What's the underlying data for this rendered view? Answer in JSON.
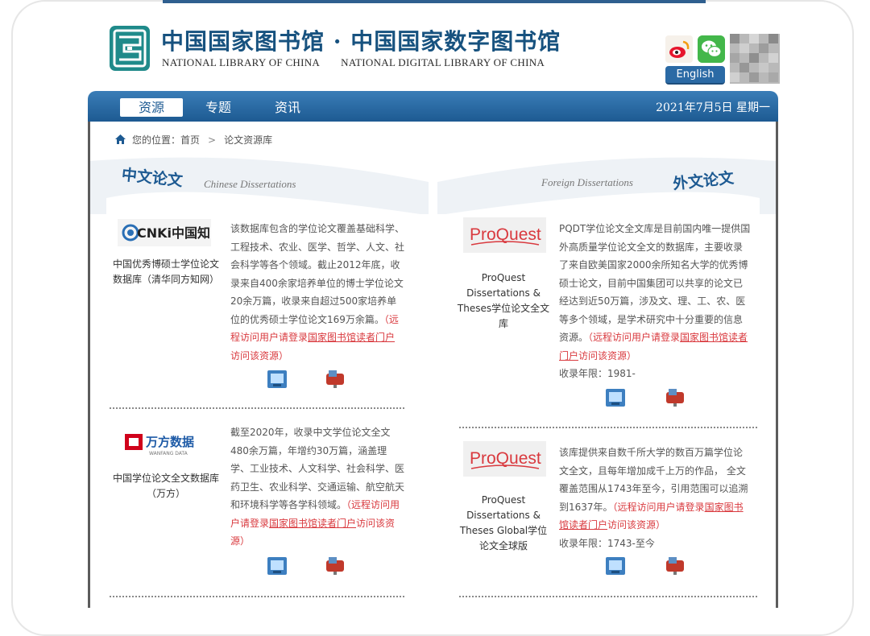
{
  "header": {
    "title_cn": "中国国家图书馆 · 中国国家数字图书馆",
    "title_en_1": "NATIONAL LIBRARY OF CHINA",
    "title_en_2": "NATIONAL DIGITAL LIBRARY OF CHINA",
    "english_label": "English"
  },
  "nav": {
    "tabs": [
      {
        "label": "资源"
      },
      {
        "label": "专题"
      },
      {
        "label": "资讯"
      }
    ],
    "date": "2021年7月5日 星期一"
  },
  "breadcrumb": {
    "prefix": "您的位置：首页",
    "sep": ">",
    "current": "论文资源库"
  },
  "sections": {
    "chinese": {
      "title": "中文论文",
      "subtitle": "Chinese Dissertations"
    },
    "foreign": {
      "title": "外文论文",
      "subtitle": "Foreign Dissertations"
    }
  },
  "entries": {
    "cnki": {
      "logo_text": "CNKi中国知网",
      "name": "中国优秀博硕士学位论文数据库（清华同方知网）",
      "desc": "该数据库包含的学位论文覆盖基础科学、工程技术、农业、医学、哲学、人文、社会科学等各个领域。截止2012年底，收录来自400余家培养单位的博士学位论文 20余万篇，收录来自超过500家培养单位的优秀硕士学位论文169万余篇。",
      "remote_pre": "（远程访问用户请登录",
      "remote_link": "国家图书馆读者门户",
      "remote_post": "访问该资源）"
    },
    "wanfang": {
      "logo_text": "万方数据",
      "logo_sub": "WANFANG DATA",
      "name": "中国学位论文全文数据库（万方）",
      "desc": "截至2020年，收录中文学位论文全文480余万篇，年增约30万篇，涵盖理学、工业技术、人文科学、社会科学、医药卫生、农业科学、交通运输、航空航天和环境科学等各学科领域。",
      "remote_pre": "（远程访问用户请登录",
      "remote_link": "国家图书馆读者门户",
      "remote_post": "访问该资源）"
    },
    "pqdt": {
      "logo_text": "ProQuest",
      "name": "ProQuest Dissertations & Theses学位论文全文库",
      "desc": "PQDT学位论文全文库是目前国内唯一提供国外高质量学位论文全文的数据库，主要收录了来自欧美国家2000余所知名大学的优秀博硕士论文，目前中国集团可以共享的论文已经达到近50万篇，涉及文、理、工、农、医等多个领域，是学术研究中十分重要的信息资源。",
      "remote_pre": "（远程访问用户请登录",
      "remote_link": "国家图书馆读者门户",
      "remote_post": "访问该资源）",
      "years": "收录年限：1981-"
    },
    "pqdt_global": {
      "logo_text": "ProQuest",
      "name": "ProQuest Dissertations & Theses Global学位论文全球版",
      "desc": "该库提供来自数千所大学的数百万篇学位论文全文，且每年增加成千上万的作品， 全文覆盖范围从1743年至今，引用范围可以追溯到1637年。",
      "remote_pre": "（远程访问用户请登录",
      "remote_link": "国家图书馆读者门户",
      "remote_post": "访问该资源）",
      "years": "收录年限：1743-至今"
    }
  }
}
